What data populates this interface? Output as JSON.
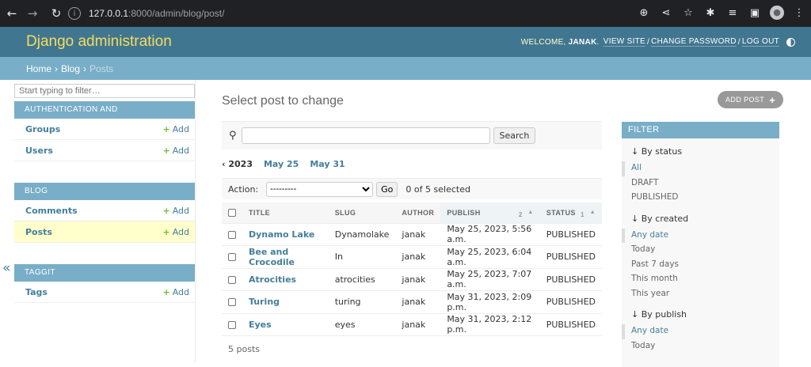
{
  "browser": {
    "url_host": "127.0.0.1",
    "url_path": ":8000/admin/blog/post/"
  },
  "header": {
    "branding": "Django administration",
    "welcome": "Welcome,",
    "username": "janak",
    "view_site": "View site",
    "change_password": "Change password",
    "log_out": "Log out"
  },
  "breadcrumbs": {
    "home": "Home",
    "blog": "Blog",
    "current": "Posts",
    "separator": "›"
  },
  "sidebar": {
    "filter_placeholder": "Start typing to filter…",
    "collapse": "«",
    "add_label": "Add",
    "modules": [
      {
        "caption": "Authentication and Authorization",
        "items": [
          {
            "name": "Groups"
          },
          {
            "name": "Users"
          }
        ]
      },
      {
        "caption": "Blog",
        "items": [
          {
            "name": "Comments"
          },
          {
            "name": "Posts"
          }
        ]
      },
      {
        "caption": "Taggit",
        "items": [
          {
            "name": "Tags"
          }
        ]
      }
    ]
  },
  "content": {
    "title": "Select post to change",
    "add_button": "Add post",
    "search_button": "Search",
    "date_hierarchy": {
      "back": "‹ 2023",
      "links": [
        "May 25",
        "May 31"
      ]
    },
    "actions": {
      "label": "Action:",
      "selected_option": "---------",
      "go": "Go",
      "counter": "0 of 5 selected"
    },
    "columns": [
      "Title",
      "Slug",
      "Author",
      "Publish",
      "Status"
    ],
    "sort_indicators": {
      "publish": "2",
      "status": "1",
      "arrow": "▲"
    },
    "rows": [
      {
        "title": "Dynamo Lake",
        "slug": "Dynamolake",
        "author": "janak",
        "publish": "May 25, 2023, 5:56 a.m.",
        "status": "PUBLISHED"
      },
      {
        "title": "Bee and Crocodile",
        "slug": "In",
        "author": "janak",
        "publish": "May 25, 2023, 6:04 a.m.",
        "status": "PUBLISHED"
      },
      {
        "title": "Atrocities",
        "slug": "atrocities",
        "author": "janak",
        "publish": "May 25, 2023, 7:07 a.m.",
        "status": "PUBLISHED"
      },
      {
        "title": "Turing",
        "slug": "turing",
        "author": "janak",
        "publish": "May 31, 2023, 2:09 p.m.",
        "status": "PUBLISHED"
      },
      {
        "title": "Eyes",
        "slug": "eyes",
        "author": "janak",
        "publish": "May 31, 2023, 2:12 p.m.",
        "status": "PUBLISHED"
      }
    ],
    "paginator": "5 posts"
  },
  "filter": {
    "title": "Filter",
    "groups": [
      {
        "title": "↓ By status",
        "options": [
          "All",
          "DRAFT",
          "PUBLISHED"
        ]
      },
      {
        "title": "↓ By created",
        "options": [
          "Any date",
          "Today",
          "Past 7 days",
          "This month",
          "This year"
        ]
      },
      {
        "title": "↓ By publish",
        "options": [
          "Any date",
          "Today"
        ]
      }
    ]
  }
}
